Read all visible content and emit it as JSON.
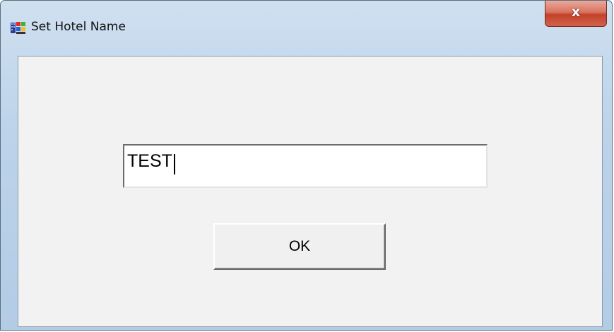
{
  "window": {
    "title": "Set Hotel Name",
    "close_glyph": "x",
    "icon": "application-icon"
  },
  "form": {
    "hotel_name_value": "TEST",
    "ok_label": "OK"
  },
  "colors": {
    "client_background": "#f2f2f2",
    "close_button_red": "#c4412a",
    "titlebar_blue": "#bcd3ea"
  }
}
